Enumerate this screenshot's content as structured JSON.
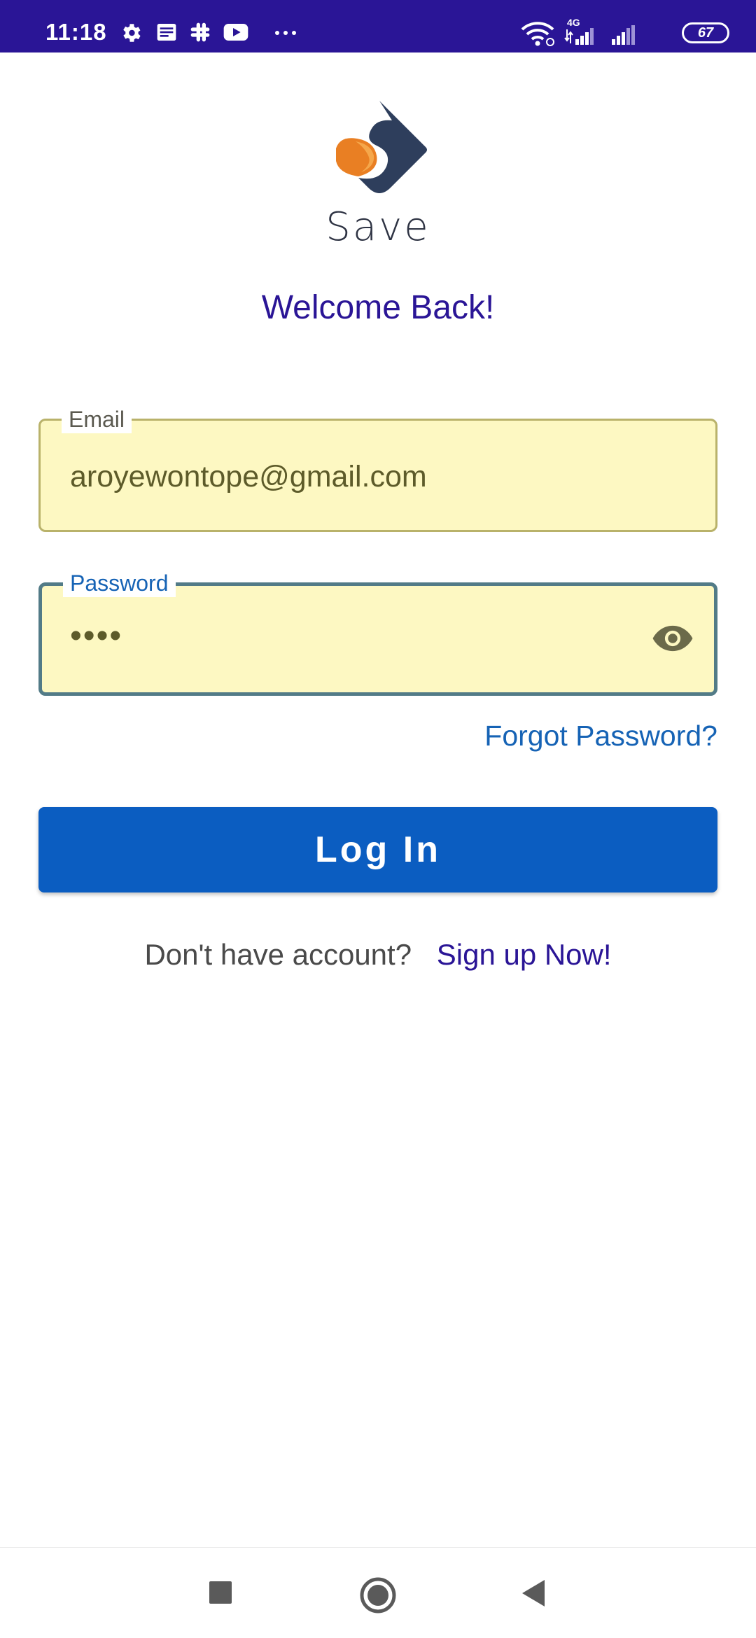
{
  "status_bar": {
    "time": "11:18",
    "network": "4G",
    "battery": "67",
    "left_icons": [
      "gear-icon",
      "news-icon",
      "slack-icon",
      "youtube-icon",
      "more-dots-icon"
    ],
    "right_icons": [
      "wifi-icon",
      "signal-4g-icon",
      "signal-icon",
      "battery-icon"
    ]
  },
  "app": {
    "logo_text": "Save",
    "welcome": "Welcome Back!"
  },
  "form": {
    "email_label": "Email",
    "email_value": "aroyewontope@gmail.com",
    "password_label": "Password",
    "password_value": "••••",
    "forgot_label": "Forgot Password?",
    "login_label": "Log In",
    "signup_prompt": "Don't have account?",
    "signup_link": "Sign up Now!"
  },
  "nav": {
    "icons": [
      "recents-square-icon",
      "home-circle-icon",
      "back-triangle-icon"
    ]
  },
  "colors": {
    "status_bar": "#2a1596",
    "primary": "#0b5dc1",
    "accent_text": "#2a1596",
    "link": "#1663b5",
    "field_fill": "#fdf8c2",
    "logo_orange": "#e97f23",
    "logo_navy": "#2e3e5c"
  }
}
